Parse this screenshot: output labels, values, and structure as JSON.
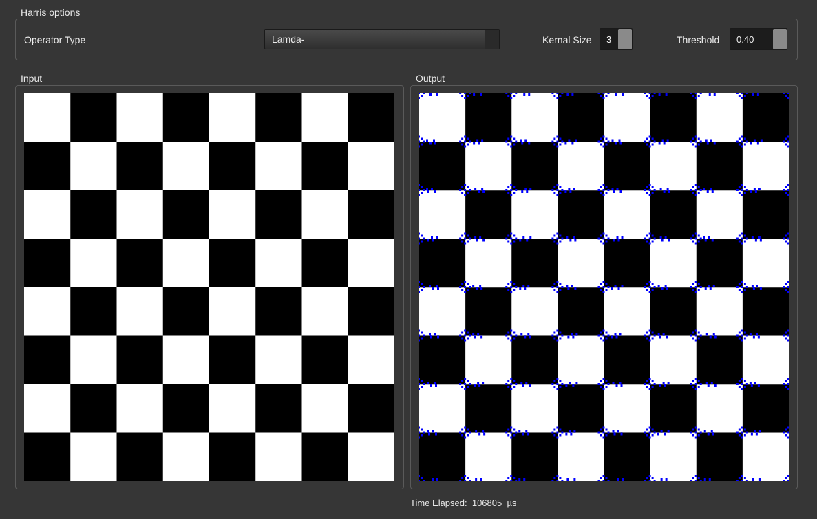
{
  "harris_options": {
    "title": "Harris options",
    "operator_label": "Operator Type",
    "operator_value": "Lamda-",
    "kernel_label": "Kernal Size",
    "kernel_value": "3",
    "threshold_label": "Threshold",
    "threshold_value": "0.40"
  },
  "input": {
    "title": "Input"
  },
  "output": {
    "title": "Output"
  },
  "status": {
    "label": "Time Elapsed:",
    "value": "106805",
    "unit": "µs"
  },
  "colors": {
    "background": "#363636",
    "board_dark": "#000000",
    "board_light": "#ffffff",
    "corner_marker": "#0000ff"
  },
  "checkerboard": {
    "rows": 8,
    "cols": 8,
    "top_left": "white"
  }
}
